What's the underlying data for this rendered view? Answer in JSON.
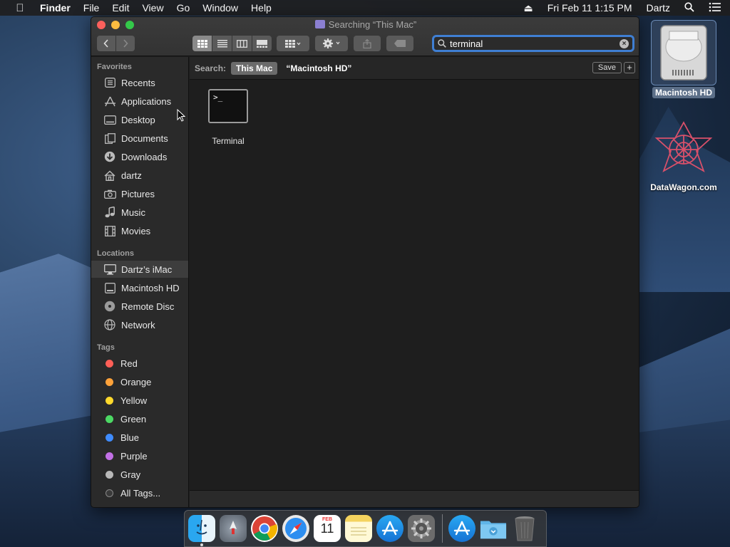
{
  "menubar": {
    "app_name": "Finder",
    "menus": [
      "File",
      "Edit",
      "View",
      "Go",
      "Window",
      "Help"
    ],
    "datetime": "Fri Feb 11  1:15 PM",
    "user": "Dartz"
  },
  "window": {
    "title": "Searching “This Mac”"
  },
  "search": {
    "value": "terminal",
    "clear_label": "×"
  },
  "sidebar": {
    "favorites_title": "Favorites",
    "favorites": [
      "Recents",
      "Applications",
      "Desktop",
      "Documents",
      "Downloads",
      "dartz",
      "Pictures",
      "Music",
      "Movies"
    ],
    "locations_title": "Locations",
    "locations": [
      "Dartz’s iMac",
      "Macintosh HD",
      "Remote Disc",
      "Network"
    ],
    "tags_title": "Tags",
    "tags": [
      {
        "name": "Red",
        "color": "#ff5f57"
      },
      {
        "name": "Orange",
        "color": "#ffa23a"
      },
      {
        "name": "Yellow",
        "color": "#ffd92c"
      },
      {
        "name": "Green",
        "color": "#4cd964"
      },
      {
        "name": "Blue",
        "color": "#3f8cff"
      },
      {
        "name": "Purple",
        "color": "#c270e6"
      },
      {
        "name": "Gray",
        "color": "#b8b8b8"
      }
    ],
    "all_tags": "All Tags..."
  },
  "scope": {
    "label": "Search:",
    "this_mac": "This Mac",
    "hd": "“Macintosh HD”",
    "save": "Save",
    "plus": "+"
  },
  "results": [
    {
      "name": "Terminal",
      "glyph": ">_"
    }
  ],
  "desktop": {
    "hd_label": "Macintosh HD",
    "datawagon_label": "DataWagon.com"
  },
  "dock": {
    "apps": [
      "Finder",
      "Launchpad",
      "Chrome",
      "Safari",
      "Calendar",
      "Notes",
      "App Store",
      "System Preferences"
    ],
    "extras": [
      "App Store Downloads",
      "Downloads Folder",
      "Trash"
    ],
    "calendar_month": "FEB",
    "calendar_day": "11"
  },
  "colors": {
    "accent": "#3f7fd3"
  }
}
